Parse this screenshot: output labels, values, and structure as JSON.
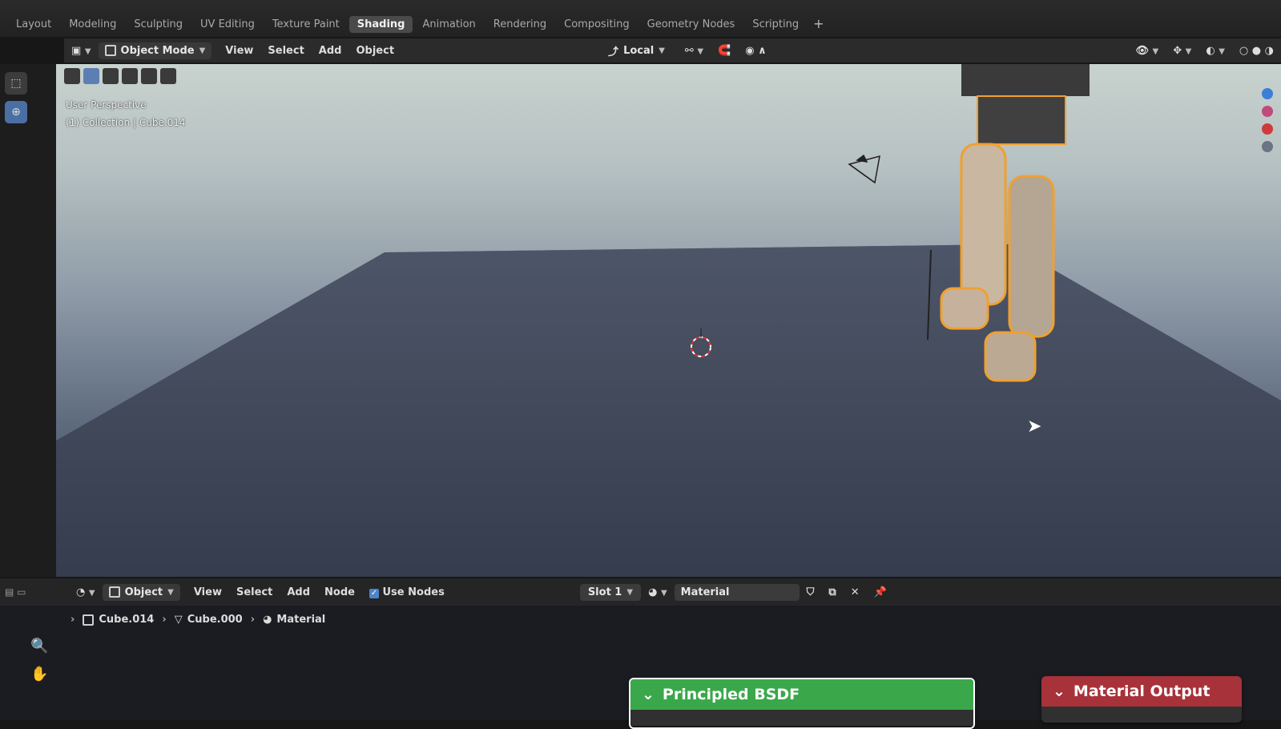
{
  "workspace_tabs": [
    "Layout",
    "Modeling",
    "Sculpting",
    "UV Editing",
    "Texture Paint",
    "Shading",
    "Animation",
    "Rendering",
    "Compositing",
    "Geometry Nodes",
    "Scripting"
  ],
  "active_tab": "Shading",
  "add_tab_symbol": "+",
  "viewport_header": {
    "mode": "Object Mode",
    "menus": [
      "View",
      "Select",
      "Add",
      "Object"
    ],
    "transform_orientation": "Local"
  },
  "viewport": {
    "perspective_label": "User Perspective",
    "collection_label": "(1) Collection | Cube.014"
  },
  "node_header": {
    "object_type": "Object",
    "menus": [
      "View",
      "Select",
      "Add",
      "Node"
    ],
    "use_nodes_label": "Use Nodes",
    "use_nodes_checked": true,
    "slot": "Slot 1",
    "material": "Material"
  },
  "breadcrumb": {
    "object": "Cube.014",
    "mesh": "Cube.000",
    "material": "Material"
  },
  "nodes": {
    "principled": "Principled BSDF",
    "output": "Material Output"
  },
  "colors": {
    "principled_header": "#3aa84a",
    "output_header": "#a8323a",
    "selection_outline": "#f0a030",
    "active_tab": "#4a4a4a"
  }
}
